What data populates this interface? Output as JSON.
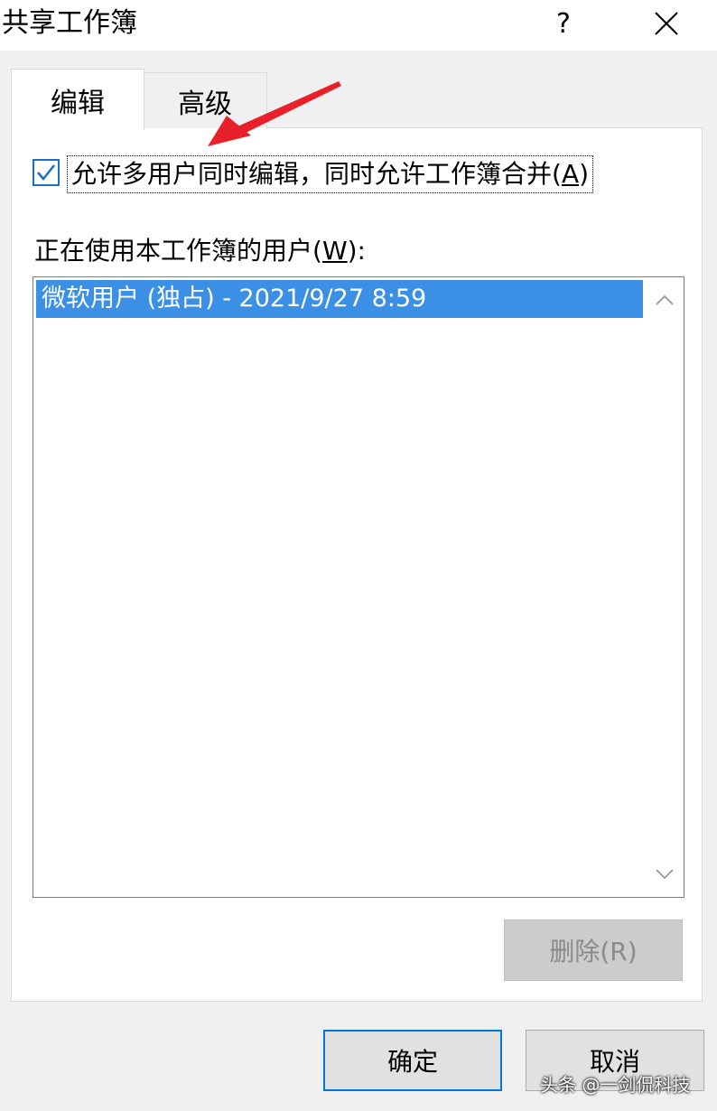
{
  "dialog": {
    "title": "共享工作簿",
    "help_label": "?",
    "close_icon": "close-icon"
  },
  "tabs": [
    {
      "label": "编辑",
      "active": true
    },
    {
      "label": "高级",
      "active": false
    }
  ],
  "edit_tab": {
    "allow_multiuser": {
      "checked": true,
      "label_prefix": "允许多用户同时编辑，同时允许工作簿合并(",
      "accelerator": "A",
      "label_suffix": ")"
    },
    "users_label_prefix": "正在使用本工作簿的用户(",
    "users_label_accelerator": "W",
    "users_label_suffix": "):",
    "users": [
      {
        "text": "微软用户 (独占) - 2021/9/27 8:59",
        "selected": true
      }
    ],
    "remove_button": {
      "label": "删除(R)",
      "enabled": false
    }
  },
  "footer": {
    "ok_label": "确定",
    "cancel_label": "取消"
  },
  "colors": {
    "selection": "#3b8fe5",
    "focus_border": "#0078d7",
    "annotation_arrow": "#e8202a"
  },
  "watermark": "头条 @一剑侃科技"
}
